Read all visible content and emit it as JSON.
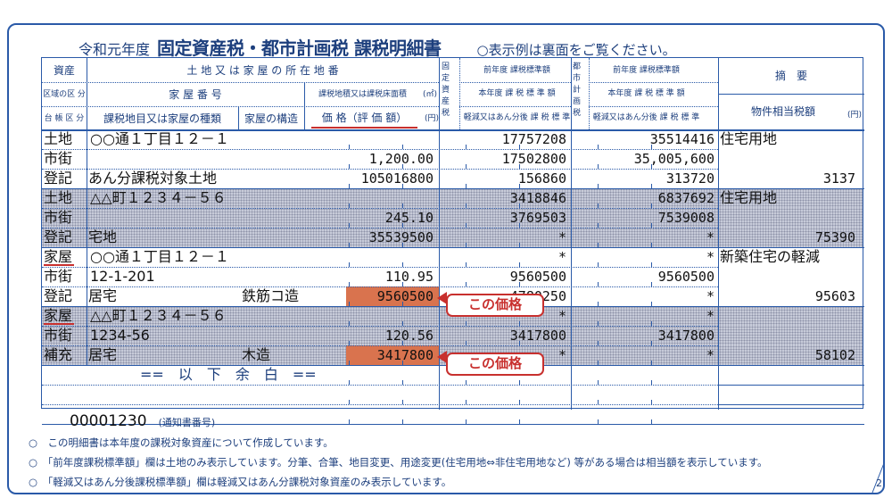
{
  "header": {
    "era": "令和元年度",
    "title": "固定資産税・都市計画税 課税明細書",
    "note": "○表示例は裏面をご覧ください。"
  },
  "columns": {
    "r1": {
      "a": "資産",
      "b": "土 地 又 は 家 屋 の 所 在 地 番"
    },
    "r2": {
      "a": "区域の区 分",
      "b": "家 屋 番 号",
      "c": "課税地積又は課税床面積",
      "c_unit": "(㎡)"
    },
    "r3": {
      "a": "台 帳 区 分",
      "b": "課税地目又は家屋の種類",
      "c": "家屋の構造",
      "d": "価 格（評 価 額）",
      "d_unit": "(円)"
    },
    "fixed_label": "固定資産税",
    "city_label": "都市計画税",
    "fixed": {
      "l1": "前年度 課税標準額",
      "l2": "本年度 課 税 標 準 額",
      "l3": "軽減又はあん分後 課 税 標 準 額",
      "unit": "(円)",
      "side1": "本",
      "side2": "年度"
    },
    "city": {
      "l1": "前年度 課税標準額",
      "l2": "本年度 課 税 標 準 額",
      "l3": "軽減又はあん分後 課 税 標 準 額",
      "unit": "(円)",
      "side1": "本",
      "side2": "年度"
    },
    "remark": "摘　要",
    "tax": "物件相当税額",
    "tax_unit": "(円)"
  },
  "rows": [
    {
      "cls": "土地",
      "loc": "○○通１丁目１２－１",
      "f1": "17757208",
      "c1": "35514416",
      "remark": "住宅用地"
    },
    {
      "cls": "市街",
      "area": "1,200.00",
      "f2": "17502800",
      "c2": "35,005,600"
    },
    {
      "cls": "登記",
      "kind": "あん分課税対象土地",
      "price": "105016800",
      "f3": "156860",
      "c3": "313720",
      "tax": "3137"
    },
    {
      "cls": "土地",
      "loc": "△△町１２３４－５６",
      "f1": "3418846",
      "c1": "6837692",
      "remark": "住宅用地"
    },
    {
      "cls": "市街",
      "area": "245.10",
      "f2": "3769503",
      "c2": "7539008"
    },
    {
      "cls": "登記",
      "kind": "宅地",
      "price": "35539500",
      "f3": "*",
      "c3": "*",
      "tax": "75390"
    },
    {
      "cls": "家屋",
      "loc": "○○通１丁目１２－１",
      "f1": "*",
      "c1": "*",
      "remark": "新築住宅の軽減"
    },
    {
      "cls": "市街",
      "loc": "12-1-201",
      "area": "110.95",
      "f2": "9560500",
      "c2": "9560500"
    },
    {
      "cls": "登記",
      "kind": "居宅",
      "struct": "鉄筋コ造",
      "price": "9560500",
      "f3": "4780250",
      "c3": "*",
      "tax": "95603"
    },
    {
      "cls": "家屋",
      "loc": "△△町１２３４－５６",
      "f1": "*",
      "c1": "*"
    },
    {
      "cls": "市街",
      "loc": "1234-56",
      "area": "120.56",
      "f2": "3417800",
      "c2": "3417800"
    },
    {
      "cls": "補充",
      "kind": "居宅",
      "struct": "木造",
      "price": "3417800",
      "f3": "*",
      "c3": "*",
      "tax": "58102"
    }
  ],
  "blank_label": "==　以　下　余　白　==",
  "callout": "この価格",
  "notice_no": "00001230",
  "notice_label": "(通知書番号)",
  "notes": [
    "○　この明細書は本年度の課税対象資産について作成しています。",
    "○　「前年度課税標準額」欄は土地のみ表示しています。分筆、合筆、地目変更、用途変更(住宅用地⇔非住宅用地など) 等がある場合は相当額を表示しています。",
    "○　「軽減又はあん分後課税標準額」欄は軽減又はあん分課税対象資産のみ表示しています。"
  ],
  "page": "2",
  "colors": {
    "line": "#2a5aa8",
    "text": "#1d3f7d",
    "accent": "#c8302e",
    "highlight": "#d9734e",
    "shade": "#c7cbd9"
  }
}
